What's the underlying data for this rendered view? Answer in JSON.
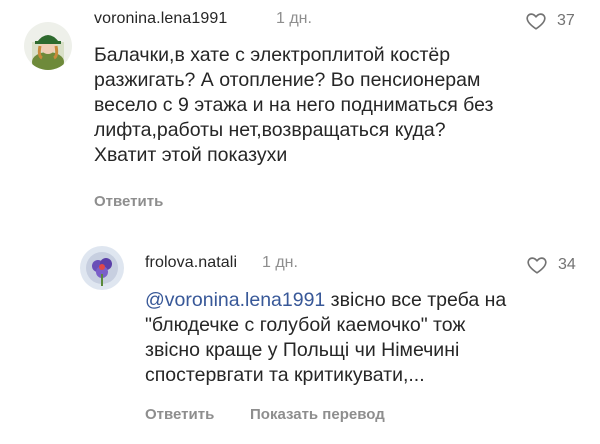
{
  "comments": [
    {
      "username": "voronina.lena1991",
      "time": "1 дн.",
      "likes": "37",
      "text": "Балачки,в хате с электроплитой костёр\nразжигать? А отопление? Во пенсионерам\nвесело с 9 этажа и на него подниматься без\nлифта,работы нет,возвращаться куда?\nХватит этой показухи",
      "reply_label": "Ответить",
      "avatar_icon": "avatar-woman-green-hat"
    },
    {
      "username": "frolova.natali",
      "time": "1 дн.",
      "likes": "34",
      "mention": "@voronina.lena1991",
      "text": " звісно все треба на\n\"блюдечке с голубой каемочко\" тож\nзвісно краще у Польщі чи Німечині\nспостервгати та критикувати,...",
      "reply_label": "Ответить",
      "translate_label": "Показать перевод",
      "avatar_icon": "avatar-flower"
    }
  ],
  "colors": {
    "text": "#262626",
    "muted": "#8e8e8e",
    "mention": "#385898"
  }
}
